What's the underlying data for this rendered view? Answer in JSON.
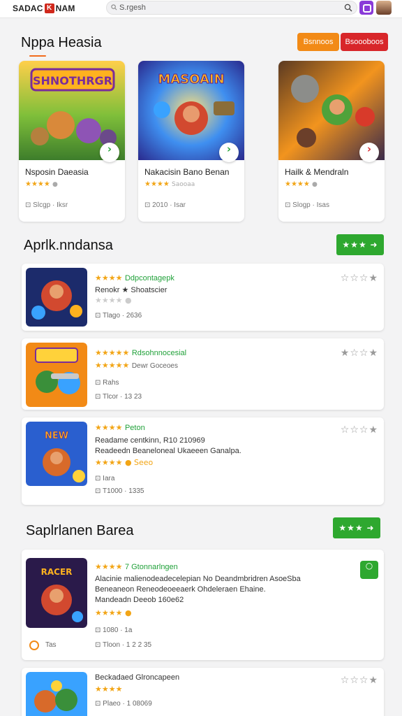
{
  "header": {
    "logo_left": "SADAC",
    "logo_mark": "K",
    "logo_right": "NAM",
    "search_placeholder": "Search",
    "search_value": "S.rgesh"
  },
  "section1": {
    "title": "Nppa Heasia",
    "buttons": [
      "Bsnnoos",
      "Bsoooboos"
    ],
    "cards": [
      {
        "title": "Nsposin Daeasia",
        "stars": "★★★★",
        "rating_extra": "●",
        "meta": "Slcgp · Iksr",
        "art_text": "SHNOTHRGR"
      },
      {
        "title": "Nakacisin Bano Benan",
        "stars": "★★★★",
        "rating_extra": "Saooaa",
        "meta": "2010 · Isar",
        "art_text": "MASOAIN"
      },
      {
        "title": "Hailk & Mendraln",
        "stars": "★★★★",
        "rating_extra": "●",
        "meta": "Slogp · Isas",
        "art_text": ""
      }
    ]
  },
  "section2": {
    "title": "Aprlk.nndansa",
    "button": "★★★ ➜",
    "items": [
      {
        "stars": "★★★★",
        "name": "Ddpcontagepk",
        "line1": "Renokr ★ Shoatscier",
        "rating2": "★★★★ ●",
        "meta": "Tlago · 2636",
        "rating": "☆☆☆★"
      },
      {
        "stars": "★★★★★",
        "name": "Rdsohnnocesial",
        "line1": "Dewr Goceoes",
        "rating2": "★★★★★",
        "meta1": "Rahs",
        "meta": "Tlcor · 13 23",
        "rating": "★☆☆★"
      },
      {
        "stars": "★★★★",
        "name": "Peton",
        "line1": "Readame centkinn, R10 210969",
        "line2": "Readeedn Beaneloneal Ukaeeen Ganalpa.",
        "rating2": "★★★★ ● Seeo",
        "meta1": "Iara",
        "meta": "T1000 · 1335",
        "rating": "☆☆☆★"
      }
    ]
  },
  "section3": {
    "title": "Saplrlanen Barea",
    "button": "★★★ ➜",
    "items": [
      {
        "stars": "★★★★",
        "name": "7 Gtonnarlngen",
        "line1": "Alacinie malienodeadecelepian No Deandmbridren AsoeSba",
        "line2": "Beneaneon Reneodeoeeaerk Ohdeleraen Ehaine.",
        "line3": "Mandeadn Deeob 160e62",
        "rating2": "★★★★ ●",
        "meta1": "1080 · 1a",
        "meta": "Tloon · 1 2 2 35",
        "extra": "Tas"
      },
      {
        "stars": "★★★★",
        "name": "Beckadaed Glroncapeen",
        "line1": "",
        "rating2": "",
        "meta": "Plaeo · 1 08069",
        "rating": "☆☆☆★"
      }
    ]
  }
}
